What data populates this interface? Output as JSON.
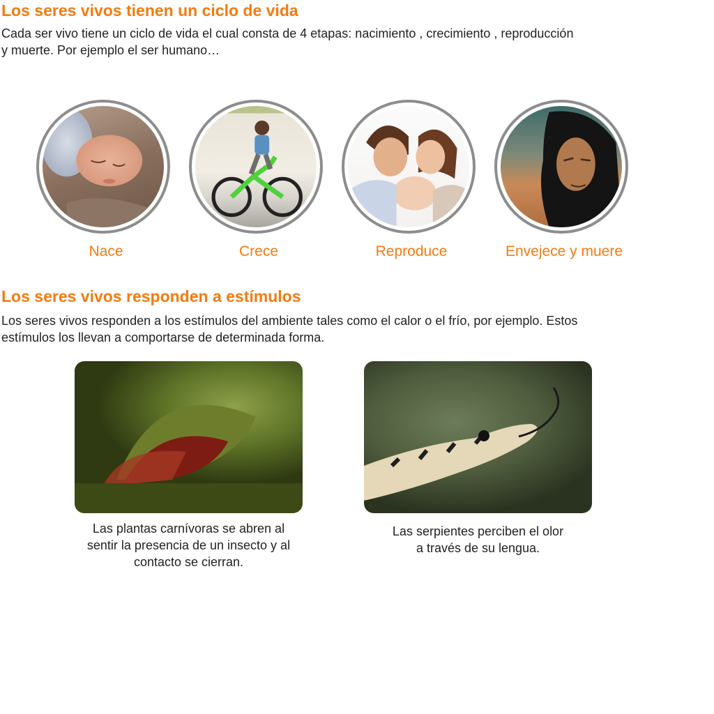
{
  "section1": {
    "title": "Los seres vivos tienen un ciclo de vida",
    "text": "Cada ser vivo tiene un ciclo de vida el cual consta de 4 etapas: nacimiento , crecimiento , reproducción\ny muerte. Por ejemplo el ser humano…",
    "stages": [
      {
        "label": "Nace",
        "icon": "sleeping-baby-photo"
      },
      {
        "label": "Crece",
        "icon": "boy-on-bicycle-photo"
      },
      {
        "label": "Reproduce",
        "icon": "family-with-baby-photo"
      },
      {
        "label": "Envejece y muere",
        "icon": "elderly-woman-photo"
      }
    ]
  },
  "section2": {
    "title": "Los seres vivos responden a estímulos",
    "text": "Los seres vivos responden a los estímulos del ambiente tales como el calor o el frío, por ejemplo. Estos\nestímulos los llevan a comportarse de determinada forma.",
    "examples": [
      {
        "caption": "Las plantas carnívoras se abren al\nsentir la presencia de un insecto y al\ncontacto se cierran.",
        "icon": "venus-flytrap-photo"
      },
      {
        "caption": "Las serpientes perciben el olor\na través de su lengua.",
        "icon": "snake-tongue-photo"
      }
    ]
  },
  "colors": {
    "accent": "#f47b0f",
    "text": "#222222",
    "ring": "#8d8d8d"
  }
}
